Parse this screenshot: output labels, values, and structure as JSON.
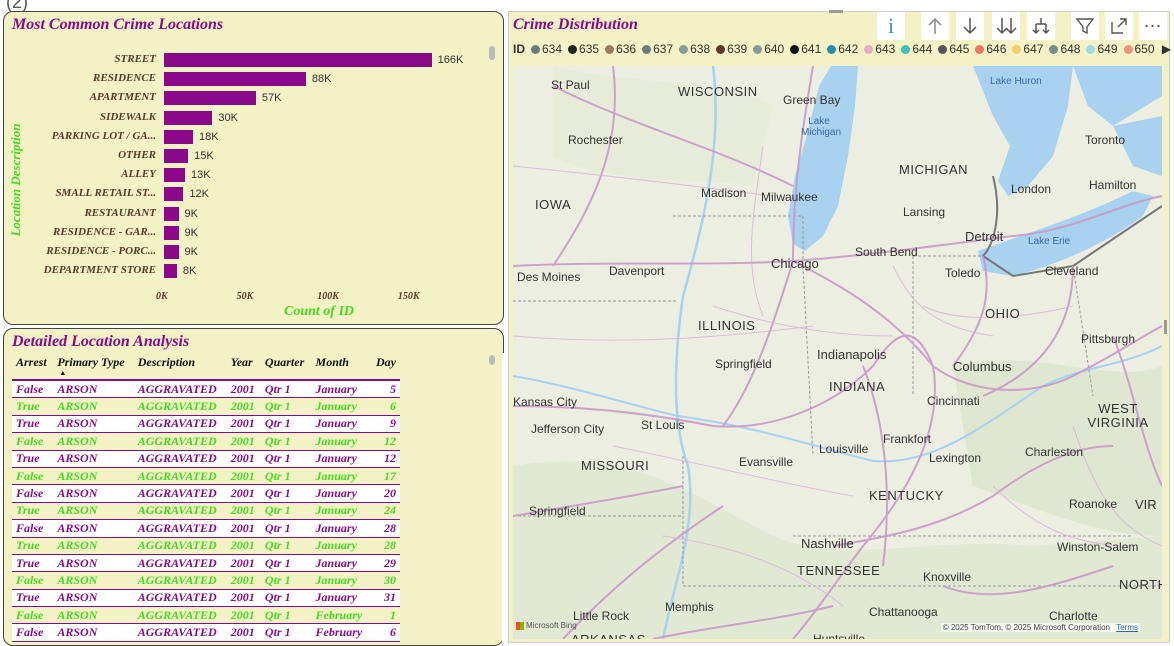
{
  "bar_panel": {
    "title": "Most Common Crime Locations",
    "ylabel": "Location Description",
    "xlabel": "Count of ID"
  },
  "chart_data": {
    "type": "bar",
    "orientation": "horizontal",
    "title": "Most Common Crime Locations",
    "xlabel": "Count of ID",
    "ylabel": "Location Description",
    "categories": [
      "STREET",
      "RESIDENCE",
      "APARTMENT",
      "SIDEWALK",
      "PARKING LOT / GA...",
      "OTHER",
      "ALLEY",
      "SMALL RETAIL ST...",
      "RESTAURANT",
      "RESIDENCE - GAR...",
      "RESIDENCE - PORC...",
      "DEPARTMENT STORE"
    ],
    "values": [
      166000,
      88000,
      57000,
      30000,
      18000,
      15000,
      13000,
      12000,
      9000,
      9000,
      9000,
      8000
    ],
    "value_labels": [
      "166K",
      "88K",
      "57K",
      "30K",
      "18K",
      "15K",
      "13K",
      "12K",
      "9K",
      "9K",
      "9K",
      "8K"
    ],
    "xticks": [
      "0K",
      "50K",
      "100K",
      "150K"
    ],
    "xlim": [
      0,
      165000
    ],
    "color": "#8b0a8b"
  },
  "table_panel": {
    "title": "Detailed Location Analysis",
    "columns": [
      "Arrest",
      "Primary Type",
      "Description",
      "Year",
      "Quarter",
      "Month",
      "Day"
    ],
    "rows": [
      [
        "False",
        "ARSON",
        "AGGRAVATED",
        "2001",
        "Qtr 1",
        "January",
        "5"
      ],
      [
        "True",
        "ARSON",
        "AGGRAVATED",
        "2001",
        "Qtr 1",
        "January",
        "6"
      ],
      [
        "True",
        "ARSON",
        "AGGRAVATED",
        "2001",
        "Qtr 1",
        "January",
        "9"
      ],
      [
        "False",
        "ARSON",
        "AGGRAVATED",
        "2001",
        "Qtr 1",
        "January",
        "12"
      ],
      [
        "True",
        "ARSON",
        "AGGRAVATED",
        "2001",
        "Qtr 1",
        "January",
        "12"
      ],
      [
        "False",
        "ARSON",
        "AGGRAVATED",
        "2001",
        "Qtr 1",
        "January",
        "17"
      ],
      [
        "False",
        "ARSON",
        "AGGRAVATED",
        "2001",
        "Qtr 1",
        "January",
        "20"
      ],
      [
        "True",
        "ARSON",
        "AGGRAVATED",
        "2001",
        "Qtr 1",
        "January",
        "24"
      ],
      [
        "False",
        "ARSON",
        "AGGRAVATED",
        "2001",
        "Qtr 1",
        "January",
        "28"
      ],
      [
        "True",
        "ARSON",
        "AGGRAVATED",
        "2001",
        "Qtr 1",
        "January",
        "28"
      ],
      [
        "True",
        "ARSON",
        "AGGRAVATED",
        "2001",
        "Qtr 1",
        "January",
        "29"
      ],
      [
        "False",
        "ARSON",
        "AGGRAVATED",
        "2001",
        "Qtr 1",
        "January",
        "30"
      ],
      [
        "True",
        "ARSON",
        "AGGRAVATED",
        "2001",
        "Qtr 1",
        "January",
        "31"
      ],
      [
        "False",
        "ARSON",
        "AGGRAVATED",
        "2001",
        "Qtr 1",
        "February",
        "1"
      ],
      [
        "False",
        "ARSON",
        "AGGRAVATED",
        "2001",
        "Qtr 1",
        "February",
        "6"
      ]
    ]
  },
  "map_panel": {
    "title": "Crime Distribution",
    "legend_label": "ID",
    "legend": [
      {
        "label": "634",
        "color": "#6b7b7b"
      },
      {
        "label": "635",
        "color": "#222222"
      },
      {
        "label": "636",
        "color": "#a07860"
      },
      {
        "label": "637",
        "color": "#6b7b7b"
      },
      {
        "label": "638",
        "color": "#8a9a9a"
      },
      {
        "label": "639",
        "color": "#5a3a2a"
      },
      {
        "label": "640",
        "color": "#8a9a9a"
      },
      {
        "label": "641",
        "color": "#111111"
      },
      {
        "label": "642",
        "color": "#2a8aaa"
      },
      {
        "label": "643",
        "color": "#e0b0c0"
      },
      {
        "label": "644",
        "color": "#40c0b0"
      },
      {
        "label": "645",
        "color": "#555555"
      },
      {
        "label": "646",
        "color": "#f07060"
      },
      {
        "label": "647",
        "color": "#f0d070"
      },
      {
        "label": "648",
        "color": "#7a8a8a"
      },
      {
        "label": "649",
        "color": "#a0d8e8"
      },
      {
        "label": "650",
        "color": "#f09080"
      }
    ],
    "states": [
      "WISCONSIN",
      "IOWA",
      "MICHIGAN",
      "ILLINOIS",
      "INDIANA",
      "OHIO",
      "MISSOURI",
      "KENTUCKY",
      "WEST VIRGINIA",
      "TENNESSEE",
      "NORTH"
    ],
    "cities": [
      "St Paul",
      "Green Bay",
      "Rochester",
      "Madison",
      "Milwaukee",
      "Lansing",
      "London",
      "Hamilton",
      "Toronto",
      "Detroit",
      "Chicago",
      "South Bend",
      "Toledo",
      "Cleveland",
      "Des Moines",
      "Davenport",
      "Pittsburgh",
      "Springfield",
      "Indianapolis",
      "Columbus",
      "Kansas City",
      "Cincinnati",
      "St Louis",
      "Jefferson City",
      "Frankfort",
      "Louisville",
      "Lexington",
      "Charleston",
      "Evansville",
      "Springfield",
      "Roanoke",
      "Nashville",
      "Winston-Salem",
      "Knoxville",
      "Little Rock",
      "Memphis",
      "Chattanooga",
      "Charlotte",
      "Huntsville",
      "ARKANSAS",
      "VIR"
    ],
    "water": [
      "Lake Huron",
      "Lake Michigan",
      "Lake Erie"
    ],
    "attribution": "© 2025 TomTom, © 2025 Microsoft Corporation",
    "terms": "Terms",
    "bing": "Microsoft Bing",
    "info_icon": "info-icon"
  }
}
